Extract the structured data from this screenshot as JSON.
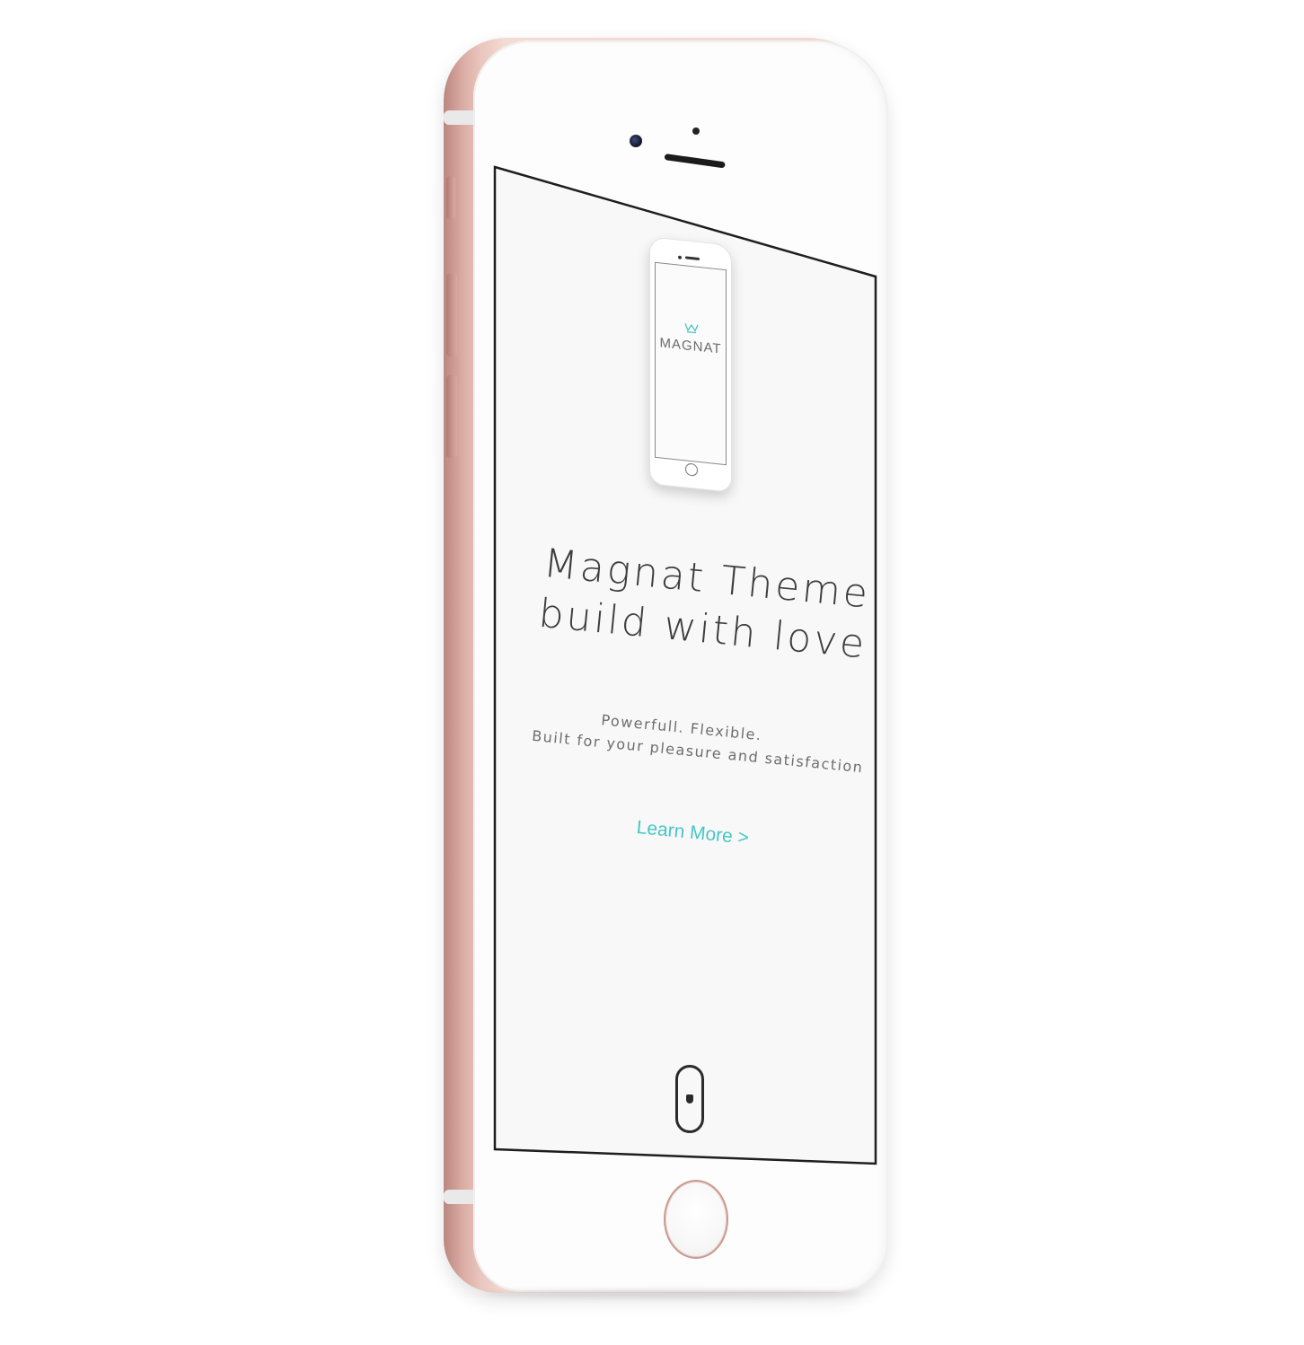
{
  "device": {
    "body_color": "#e8c4bc",
    "screen_background": "#f8f8f8"
  },
  "hero": {
    "logo_text": "MAGNAT",
    "headline_line1": "Magnat Theme",
    "headline_line2": "build with love",
    "subtitle_line1": "Powerfull. Flexible.",
    "subtitle_line2": "Built for your pleasure and satisfaction",
    "cta_label": "Learn More >",
    "accent_color": "#48c6c8"
  },
  "icons": {
    "logo": "crown-icon",
    "scroll": "mouse-scroll-icon",
    "home": "home-button"
  }
}
